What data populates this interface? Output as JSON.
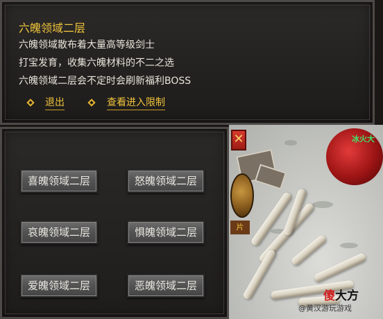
{
  "info_panel": {
    "title": "六魄领域二层",
    "lines": [
      "六魄领域散布着大量高等级剑士",
      "打宝发育，收集六魄材料的不二之选",
      "六魄领域二层会不定时会刷新福利BOSS"
    ],
    "actions": {
      "exit_label": "退出",
      "view_limit_label": "查看进入限制"
    }
  },
  "floor_buttons": [
    {
      "label": "喜魄领域二层"
    },
    {
      "label": "怒魄领域二层"
    },
    {
      "label": "哀魄领域二层"
    },
    {
      "label": "惧魄领域二层"
    },
    {
      "label": "爱魄领域二层"
    },
    {
      "label": "恶魄领域二层"
    }
  ],
  "game_view": {
    "orb_label": "冰火大",
    "tag_text": "片",
    "close_symbol": "✕"
  },
  "watermark": {
    "logo_left": "傻",
    "logo_right": "大方",
    "caption": "@黄汉游玩游戏"
  },
  "colors": {
    "accent": "#f0c43a",
    "panel": "#242221",
    "button": "#545454"
  }
}
